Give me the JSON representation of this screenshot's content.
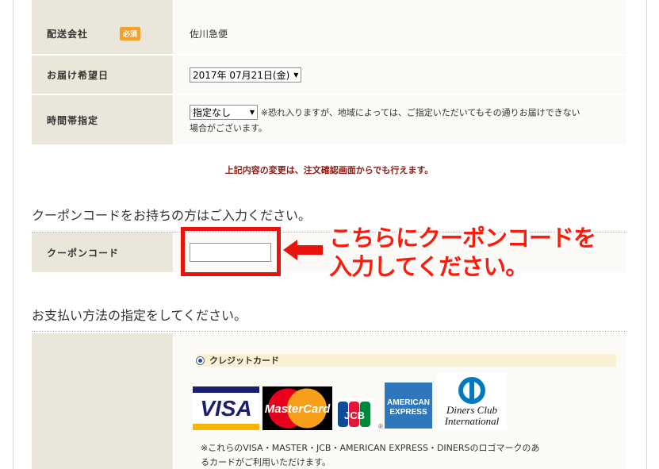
{
  "shipping": {
    "carrier_label": "配送会社",
    "required_badge": "必須",
    "carrier_value": "佐川急便"
  },
  "delivery_date": {
    "label": "お届け希望日",
    "selected": "2017年 07月21日(金)"
  },
  "time_slot": {
    "label": "時間帯指定",
    "selected": "指定なし",
    "note_line1": "※恐れ入りますが、地域によっては、ご指定いただいてもその通りお届けできない",
    "note_line2": "場合がございます。"
  },
  "change_note": "上記内容の変更は、注文確認画面からでも行えます。",
  "coupon": {
    "section_title": "クーポンコードをお持ちの方はご入力ください。",
    "label": "クーポンコード",
    "value": "",
    "callout_line1": "こちらにクーポンコードを",
    "callout_line2": "入力してください。"
  },
  "payment": {
    "section_title": "お支払い方法の指定をしてください。",
    "credit_label": "クレジットカード",
    "cards": {
      "visa": "VISA",
      "mastercard": "MasterCard",
      "jcb": "JCB",
      "amex_line1": "AMERICAN",
      "amex_line2": "EXPRESS",
      "diners_line1": "Diners Club",
      "diners_line2": "International",
      "registered": "®"
    },
    "card_note_line1": "※これらのVISA・MASTER・JCB・AMERICAN EXPRESS・DINERSのロゴマークのあ",
    "card_note_line2": "るカードがご利用いただけます。"
  },
  "colors": {
    "header_cell": "#ebe6da",
    "value_cell": "#fbfaf6",
    "badge": "#f4a12a",
    "note_red": "#8c1a12",
    "highlight": "#e8140c",
    "credit_bg": "#fcf0d4"
  }
}
